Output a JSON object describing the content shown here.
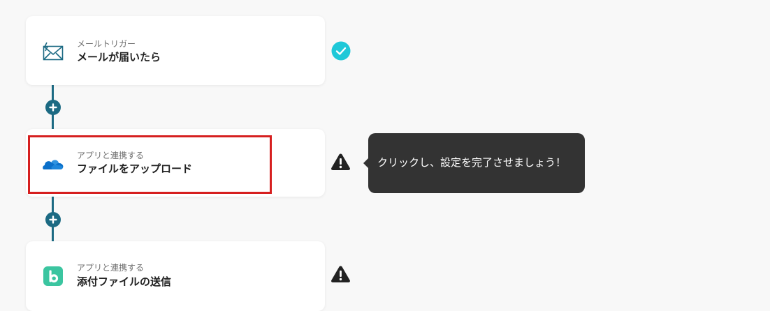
{
  "flow": {
    "steps": [
      {
        "subtitle": "メールトリガー",
        "title": "メールが届いたら",
        "icon": "mail-icon",
        "status": "check-circle-icon"
      },
      {
        "subtitle": "アプリと連携する",
        "title": "ファイルをアップロード",
        "icon": "onedrive-cloud-icon",
        "status": "warning-icon"
      },
      {
        "subtitle": "アプリと連携する",
        "title": "添付ファイルの送信",
        "icon": "b-app-icon",
        "status": "warning-icon"
      }
    ],
    "add_button_icon": "plus-icon"
  },
  "tooltip": {
    "text": "クリックし、設定を完了させましょう！"
  },
  "colors": {
    "background": "#f8f8f8",
    "connector": "#1c6a83",
    "check": "#1fc8d8",
    "warning": "#222222",
    "highlight": "#d61f1f",
    "tooltip_bg": "#333333",
    "onedrive_blue": "#0a6fc9",
    "app_green": "#3bc5a0"
  }
}
